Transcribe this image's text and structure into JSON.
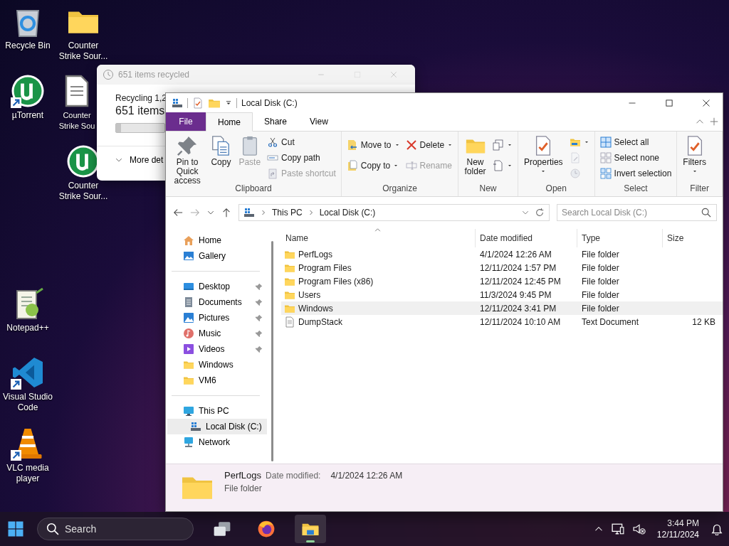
{
  "desktop_icons": [
    {
      "label": "Recycle Bin",
      "kind": "recycle",
      "shortcut": false
    },
    {
      "label": "Counter Strike Sour...",
      "kind": "folder",
      "shortcut": false
    },
    {
      "label": "µTorrent",
      "kind": "utorrent",
      "shortcut": true
    },
    {
      "label": "Counter Strike Sou",
      "kind": "file",
      "shortcut": false
    },
    {
      "label": "Counter Strike Sour...",
      "kind": "utorrent",
      "shortcut": false
    },
    {
      "label": "Notepad++",
      "kind": "notepad",
      "shortcut": false
    },
    {
      "label": "Visual Studio Code",
      "kind": "vscode",
      "shortcut": true
    },
    {
      "label": "VLC media player",
      "kind": "vlc",
      "shortcut": true
    }
  ],
  "recycle_dialog": {
    "title": "651 items recycled",
    "line_1": "Recycling 1,2",
    "line_2": "651 items",
    "level": 0.1,
    "details_button": "More det"
  },
  "explorer": {
    "title": "Local Disk (C:)",
    "tabs": [
      {
        "label": "File",
        "kind": "file",
        "selected": false
      },
      {
        "label": "Home",
        "kind": "tab",
        "selected": true
      },
      {
        "label": "Share",
        "kind": "tab",
        "selected": false
      },
      {
        "label": "View",
        "kind": "tab",
        "selected": false
      }
    ],
    "ribbon_groups": [
      {
        "label": "Clipboard",
        "stacks": [
          [
            {
              "label": "Pin to Quick access",
              "kind": "pin",
              "disabled": false,
              "dropdown": false
            }
          ],
          [
            {
              "label": "Copy",
              "kind": "copy",
              "disabled": false,
              "dropdown": false
            }
          ],
          [
            {
              "label": "Paste",
              "kind": "paste",
              "disabled": true,
              "dropdown": false
            }
          ],
          [
            {
              "label": "Cut",
              "kind": "cut",
              "disabled": false,
              "dropdown": false
            },
            {
              "label": "Copy path",
              "kind": "copypath",
              "disabled": false,
              "dropdown": false
            },
            {
              "label": "Paste shortcut",
              "kind": "pasteshortcut",
              "disabled": true,
              "dropdown": false
            }
          ]
        ]
      },
      {
        "label": "Organize",
        "stacks": [
          [
            {
              "label": "Move to",
              "kind": "moveto",
              "disabled": false,
              "dropdown": true
            },
            {
              "label": "Copy to",
              "kind": "copyto",
              "disabled": false,
              "dropdown": true
            }
          ],
          [
            {
              "label": "Delete",
              "kind": "delete",
              "disabled": false,
              "dropdown": true
            },
            {
              "label": "Rename",
              "kind": "rename",
              "disabled": true,
              "dropdown": false
            }
          ]
        ]
      },
      {
        "label": "New",
        "stacks": [
          [
            {
              "label": "New folder",
              "kind": "newfolder",
              "disabled": false,
              "dropdown": false
            }
          ],
          [
            {
              "kind": "newitem",
              "disabled": false,
              "dropdown": true
            },
            {
              "kind": "easyaccess",
              "disabled": false,
              "dropdown": true
            }
          ]
        ]
      },
      {
        "label": "Open",
        "stacks": [
          [
            {
              "label": "Properties",
              "kind": "properties",
              "disabled": false,
              "dropdown": true
            }
          ],
          [
            {
              "kind": "openfolder",
              "disabled": false,
              "dropdown": true
            },
            {
              "kind": "edit",
              "disabled": true,
              "dropdown": false
            },
            {
              "kind": "history",
              "disabled": true,
              "dropdown": false
            }
          ]
        ]
      },
      {
        "label": "Select",
        "stacks": [
          [
            {
              "label": "Select all",
              "kind": "selectall",
              "disabled": false,
              "dropdown": false
            },
            {
              "label": "Select none",
              "kind": "selectnone",
              "disabled": false,
              "dropdown": false
            },
            {
              "label": "Invert selection",
              "kind": "invert",
              "disabled": false,
              "dropdown": false
            }
          ]
        ]
      },
      {
        "label": "Filter",
        "stacks": [
          [
            {
              "label": "Filters",
              "kind": "filters",
              "disabled": false,
              "dropdown": true
            }
          ]
        ]
      }
    ],
    "breadcrumbs": [
      "This PC",
      "Local Disk (C:)"
    ],
    "search": {
      "placeholder": "Search Local Disk (C:)"
    },
    "nav_sections": [
      [
        {
          "label": "Home",
          "kind": "home",
          "pinned": false,
          "selected": false
        },
        {
          "label": "Gallery",
          "kind": "gallery",
          "pinned": false,
          "selected": false
        }
      ],
      [
        {
          "label": "Desktop",
          "kind": "desktop",
          "pinned": true,
          "selected": false
        },
        {
          "label": "Documents",
          "kind": "documents",
          "pinned": true,
          "selected": false
        },
        {
          "label": "Pictures",
          "kind": "pictures",
          "pinned": true,
          "selected": false
        },
        {
          "label": "Music",
          "kind": "music",
          "pinned": true,
          "selected": false
        },
        {
          "label": "Videos",
          "kind": "videos",
          "pinned": true,
          "selected": false
        },
        {
          "label": "Windows",
          "kind": "folder",
          "pinned": false,
          "selected": false
        },
        {
          "label": "VM6",
          "kind": "folder",
          "pinned": false,
          "selected": false
        }
      ],
      [
        {
          "label": "This PC",
          "kind": "pc",
          "pinned": false,
          "selected": false,
          "children": [
            {
              "label": "Local Disk (C:)",
              "kind": "drive",
              "pinned": false,
              "selected": true
            }
          ]
        },
        {
          "label": "Network",
          "kind": "network",
          "pinned": false,
          "selected": false
        }
      ]
    ],
    "columns": [
      "Name",
      "Date modified",
      "Type",
      "Size"
    ],
    "rows": [
      {
        "name": "PerfLogs",
        "date": "4/1/2024 12:26 AM",
        "type": "File folder",
        "kind": "folder",
        "highlighted": false
      },
      {
        "name": "Program Files",
        "date": "12/11/2024 1:57 PM",
        "type": "File folder",
        "kind": "folder",
        "highlighted": false
      },
      {
        "name": "Program Files (x86)",
        "date": "12/11/2024 12:45 PM",
        "type": "File folder",
        "kind": "folder",
        "highlighted": false
      },
      {
        "name": "Users",
        "date": "11/3/2024 9:45 PM",
        "type": "File folder",
        "kind": "folder",
        "highlighted": false
      },
      {
        "name": "Windows",
        "date": "12/11/2024 3:41 PM",
        "type": "File folder",
        "kind": "folder",
        "highlighted": true
      },
      {
        "name": "DumpStack",
        "date": "12/11/2024 10:10 AM",
        "type": "Text Document",
        "size": "12 KB",
        "kind": "file",
        "highlighted": false
      }
    ],
    "details": {
      "name": "PerfLogs",
      "date_label": "Date modified:",
      "date": "4/1/2024 12:26 AM",
      "type": "File folder"
    }
  },
  "taskbar": {
    "search_placeholder": "Search",
    "apps": [
      {
        "kind": "taskview",
        "active": false
      },
      {
        "kind": "firefox",
        "active": false
      },
      {
        "kind": "explorer",
        "active": true
      }
    ],
    "time": "3:44 PM",
    "date": "12/11/2024"
  }
}
